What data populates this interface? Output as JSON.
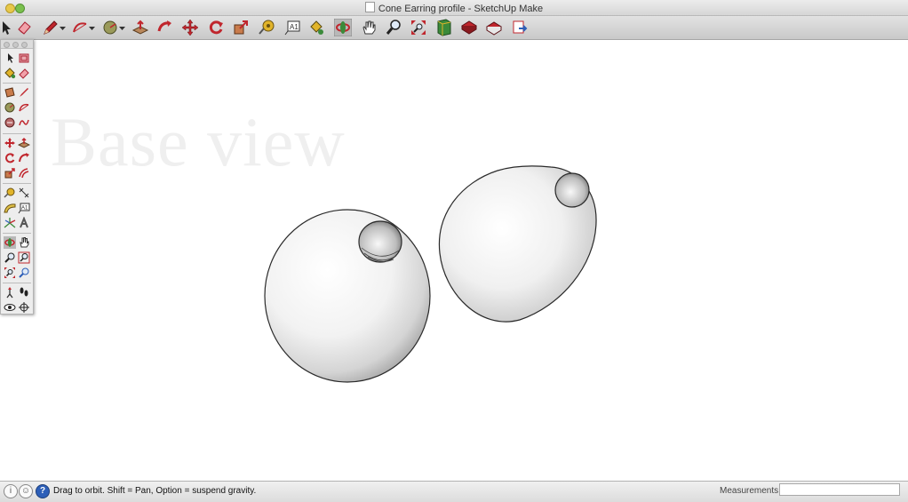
{
  "window": {
    "title": "Cone Earring profile - SketchUp Make"
  },
  "toolbar": {
    "tools": [
      "select-icon",
      "eraser-icon",
      "pencil-icon",
      "arc-icon",
      "circle-icon",
      "push-pull-icon",
      "follow-me-icon",
      "move-icon",
      "rotate-icon",
      "scale-icon",
      "tape-measure-icon",
      "text-icon",
      "paint-bucket-icon",
      "orbit-icon",
      "pan-icon",
      "zoom-icon",
      "zoom-extents-icon",
      "3d-warehouse-icon",
      "components-icon",
      "extension-warehouse-icon",
      "send-to-layout-icon"
    ]
  },
  "palette": {
    "tools": [
      "select-icon",
      "component-icon",
      "paint-bucket-icon",
      "eraser-icon",
      "rectangle-icon",
      "line-icon",
      "circle-icon",
      "arc-icon",
      "polygon-icon",
      "freehand-icon",
      "move-icon",
      "push-pull-icon",
      "rotate-icon",
      "follow-me-icon",
      "scale-icon",
      "offset-icon",
      "tape-measure-icon",
      "dimension-icon",
      "protractor-icon",
      "text-icon",
      "axes-icon",
      "3d-text-icon",
      "orbit-icon",
      "pan-icon",
      "zoom-icon",
      "zoom-window-icon",
      "zoom-extents-icon",
      "previous-view-icon",
      "position-camera-icon",
      "walk-icon",
      "look-around-icon",
      "section-plane-icon"
    ]
  },
  "viewport": {
    "scene_label": "Base view"
  },
  "statusbar": {
    "message": "Drag to orbit. Shift = Pan, Option = suspend gravity.",
    "measurements_label": "Measurements",
    "measurements_value": ""
  },
  "colors": {
    "accent_red": "#c0262d",
    "tool_green": "#3b8a3a",
    "tool_yellow": "#e1b42a"
  }
}
